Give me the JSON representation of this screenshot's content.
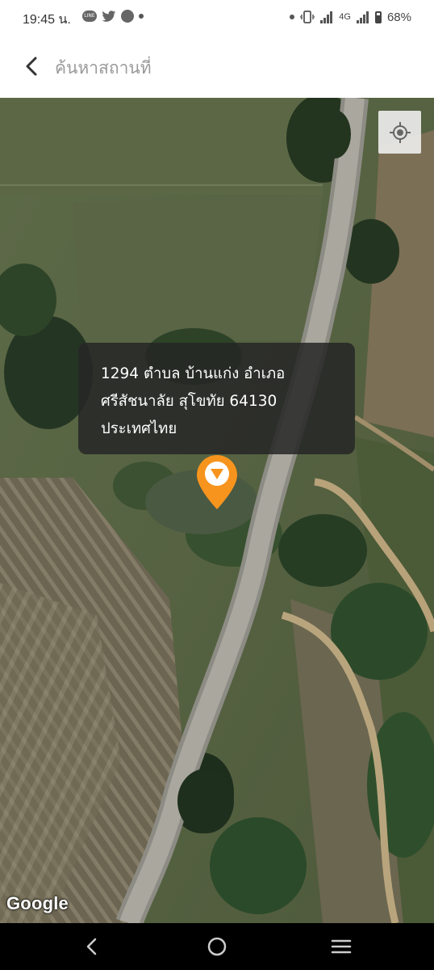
{
  "status_bar": {
    "time": "19:45 น.",
    "network": "4G",
    "battery": "68%"
  },
  "header": {
    "title": "ค้นหาสถานที่"
  },
  "map": {
    "address_lines": [
      "1294 ตำบล บ้านแก่ง อำเภอ",
      "ศรีสัชนาลัย สุโขทัย 64130",
      "ประเทศไทย"
    ],
    "attribution": "Google"
  },
  "colors": {
    "pin": "#f7941d",
    "info_box_bg": "#262626",
    "header_title": "#9a9a9a"
  }
}
